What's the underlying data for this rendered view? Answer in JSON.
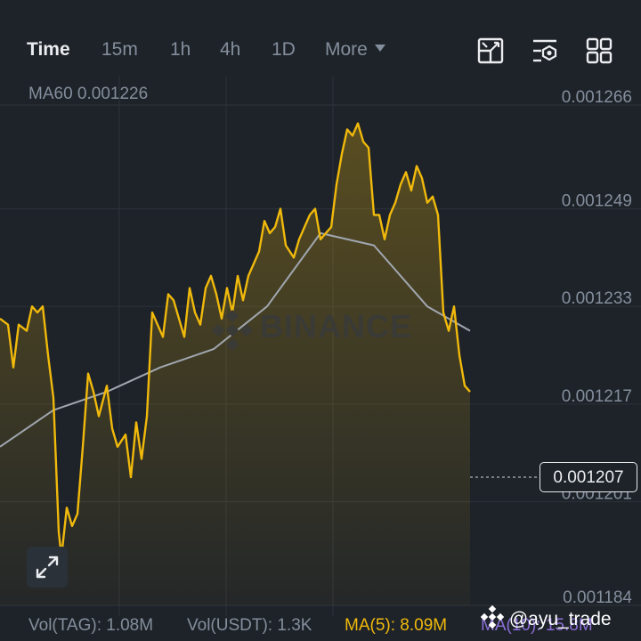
{
  "toolbar": {
    "tabs": [
      {
        "label": "Time",
        "active": true
      },
      {
        "label": "15m",
        "active": false
      },
      {
        "label": "1h",
        "active": false
      },
      {
        "label": "4h",
        "active": false
      },
      {
        "label": "1D",
        "active": false
      },
      {
        "label": "More",
        "active": false
      }
    ],
    "icons": [
      "depth-chart-icon",
      "indicator-settings-icon",
      "grid-layout-icon"
    ]
  },
  "ma60_label": "MA60 0.001226",
  "watermark": "BINANCE",
  "current_price": "0.001207",
  "footer": {
    "vol_tag": "Vol(TAG): 1.08M",
    "vol_usdt": "Vol(USDT): 1.3K",
    "ma5": "MA(5): 8.09M",
    "ma10": "MA(10): 15.8M"
  },
  "user_handle": "@ayu_trade",
  "colors": {
    "background": "#1e2329",
    "price_line": "#f0b90b",
    "ma_line": "#a1a7b0",
    "ma5_text": "#f0b90b",
    "ma10_text": "#8b6fd6",
    "grid": "#2b3139"
  },
  "chart_data": {
    "type": "area",
    "y_ticks": [
      "0.001266",
      "0.001249",
      "0.001233",
      "0.001217",
      "0.001201",
      "0.001184"
    ],
    "y_tick_values": [
      0.001266,
      0.001249,
      0.001233,
      0.001217,
      0.001201,
      0.001184
    ],
    "ylim": [
      0.001184,
      0.001266
    ],
    "x_index_range": [
      0,
      176
    ],
    "grid": true,
    "price_series": {
      "name": "",
      "x": [
        0,
        3,
        5,
        7,
        10,
        12,
        14,
        16,
        18,
        20,
        22,
        23,
        25,
        27,
        29,
        31,
        33,
        35,
        37,
        40,
        42,
        44,
        47,
        49,
        51,
        53,
        55,
        57,
        59,
        61,
        63,
        65,
        67,
        69,
        71,
        73,
        75,
        77,
        79,
        81,
        83,
        85,
        87,
        89,
        91,
        93,
        95,
        97,
        99,
        101,
        103,
        105,
        107,
        110,
        112,
        114,
        116,
        118,
        120,
        122,
        124,
        126,
        128,
        130,
        132,
        134,
        136,
        138,
        140,
        142,
        144,
        146,
        148,
        150,
        152,
        154,
        156,
        158,
        160,
        162,
        164,
        166,
        168,
        170,
        172,
        174,
        176
      ],
      "values": [
        0.001231,
        0.00123,
        0.001223,
        0.00123,
        0.001229,
        0.001233,
        0.001232,
        0.001233,
        0.001225,
        0.001218,
        0.001196,
        0.001192,
        0.0012,
        0.001197,
        0.001199,
        0.00121,
        0.001222,
        0.001219,
        0.001215,
        0.00122,
        0.001213,
        0.00121,
        0.001212,
        0.001205,
        0.001214,
        0.001208,
        0.001215,
        0.001232,
        0.00123,
        0.001228,
        0.001235,
        0.001234,
        0.001231,
        0.001228,
        0.001236,
        0.001232,
        0.00123,
        0.001236,
        0.001238,
        0.001235,
        0.001231,
        0.001236,
        0.001232,
        0.001238,
        0.001234,
        0.001238,
        0.00124,
        0.001242,
        0.001247,
        0.001245,
        0.001246,
        0.001249,
        0.001243,
        0.001241,
        0.001244,
        0.001246,
        0.001248,
        0.001249,
        0.001244,
        0.001245,
        0.001246,
        0.001253,
        0.001258,
        0.001262,
        0.001261,
        0.001263,
        0.00126,
        0.001259,
        0.001248,
        0.001248,
        0.001244,
        0.001248,
        0.00125,
        0.001253,
        0.001255,
        0.001252,
        0.001256,
        0.001254,
        0.00125,
        0.001251,
        0.001248,
        0.001232,
        0.001229,
        0.001233,
        0.001225,
        0.00122,
        0.001219
      ]
    },
    "ma60_series": {
      "name": "MA60",
      "x": [
        0,
        20,
        40,
        60,
        80,
        100,
        120,
        140,
        160,
        176
      ],
      "values": [
        0.00121,
        0.001216,
        0.001219,
        0.001223,
        0.001226,
        0.001233,
        0.001245,
        0.001243,
        0.001233,
        0.001229
      ]
    }
  }
}
